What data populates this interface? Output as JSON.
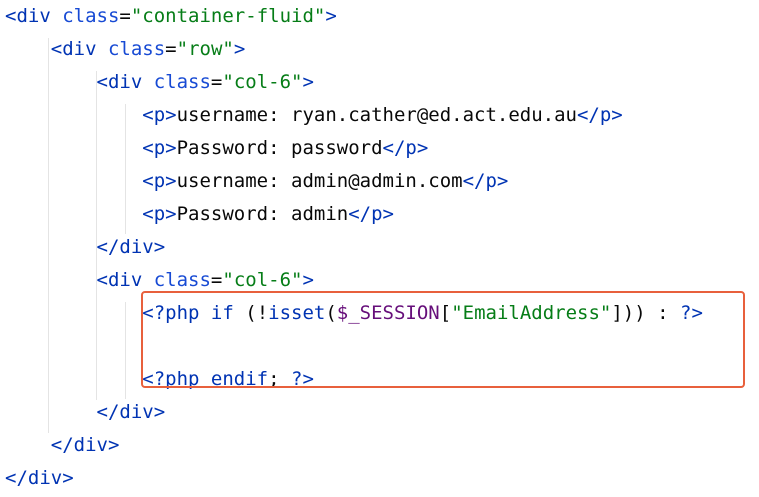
{
  "editor": {
    "lines": [
      {
        "indent": "",
        "parts": [
          {
            "c": "tag",
            "t": "<div "
          },
          {
            "c": "attr",
            "t": "class"
          },
          {
            "c": "txt",
            "t": "="
          },
          {
            "c": "str",
            "t": "\"container-fluid\""
          },
          {
            "c": "tag",
            "t": ">"
          }
        ]
      },
      {
        "indent": "    ",
        "parts": [
          {
            "c": "tag",
            "t": "<div "
          },
          {
            "c": "attr",
            "t": "class"
          },
          {
            "c": "txt",
            "t": "="
          },
          {
            "c": "str",
            "t": "\"row\""
          },
          {
            "c": "tag",
            "t": ">"
          }
        ]
      },
      {
        "indent": "        ",
        "parts": [
          {
            "c": "tag",
            "t": "<div "
          },
          {
            "c": "attr",
            "t": "class"
          },
          {
            "c": "txt",
            "t": "="
          },
          {
            "c": "str",
            "t": "\"col-6\""
          },
          {
            "c": "tag",
            "t": ">"
          }
        ]
      },
      {
        "indent": "            ",
        "parts": [
          {
            "c": "tag",
            "t": "<p>"
          },
          {
            "c": "txt",
            "t": "username: ryan.cather@ed.act.edu.au"
          },
          {
            "c": "tag",
            "t": "</p>"
          }
        ]
      },
      {
        "indent": "            ",
        "parts": [
          {
            "c": "tag",
            "t": "<p>"
          },
          {
            "c": "txt",
            "t": "Password: password"
          },
          {
            "c": "tag",
            "t": "</p>"
          }
        ]
      },
      {
        "indent": "            ",
        "parts": [
          {
            "c": "tag",
            "t": "<p>"
          },
          {
            "c": "txt",
            "t": "username: admin@admin.com"
          },
          {
            "c": "tag",
            "t": "</p>"
          }
        ]
      },
      {
        "indent": "            ",
        "parts": [
          {
            "c": "tag",
            "t": "<p>"
          },
          {
            "c": "txt",
            "t": "Password: admin"
          },
          {
            "c": "tag",
            "t": "</p>"
          }
        ]
      },
      {
        "indent": "        ",
        "parts": [
          {
            "c": "tag",
            "t": "</div>"
          }
        ]
      },
      {
        "indent": "        ",
        "parts": [
          {
            "c": "tag",
            "t": "<div "
          },
          {
            "c": "attr",
            "t": "class"
          },
          {
            "c": "txt",
            "t": "="
          },
          {
            "c": "str",
            "t": "\"col-6\""
          },
          {
            "c": "tag",
            "t": ">"
          }
        ]
      },
      {
        "indent": "            ",
        "parts": [
          {
            "c": "php",
            "t": "<?php "
          },
          {
            "c": "kw",
            "t": "if "
          },
          {
            "c": "txt",
            "t": "(!"
          },
          {
            "c": "fn",
            "t": "isset"
          },
          {
            "c": "txt",
            "t": "("
          },
          {
            "c": "var",
            "t": "$_SESSION"
          },
          {
            "c": "txt",
            "t": "["
          },
          {
            "c": "str",
            "t": "\"EmailAddress\""
          },
          {
            "c": "txt",
            "t": "])) : "
          },
          {
            "c": "php",
            "t": "?>"
          }
        ]
      },
      {
        "indent": "",
        "parts": []
      },
      {
        "indent": "            ",
        "parts": [
          {
            "c": "php",
            "t": "<?php "
          },
          {
            "c": "kw",
            "t": "endif"
          },
          {
            "c": "txt",
            "t": "; "
          },
          {
            "c": "php",
            "t": "?>"
          }
        ]
      },
      {
        "indent": "        ",
        "parts": [
          {
            "c": "tag",
            "t": "</div>"
          }
        ]
      },
      {
        "indent": "    ",
        "parts": [
          {
            "c": "tag",
            "t": "</div>"
          }
        ]
      },
      {
        "indent": "",
        "parts": [
          {
            "c": "tag",
            "t": "</div>"
          }
        ]
      }
    ]
  },
  "colors": {
    "tag": "#0033b3",
    "attribute": "#174ad4",
    "string": "#067d17",
    "text": "#080808",
    "variable": "#660e7a",
    "highlight_border": "#e8603c"
  }
}
